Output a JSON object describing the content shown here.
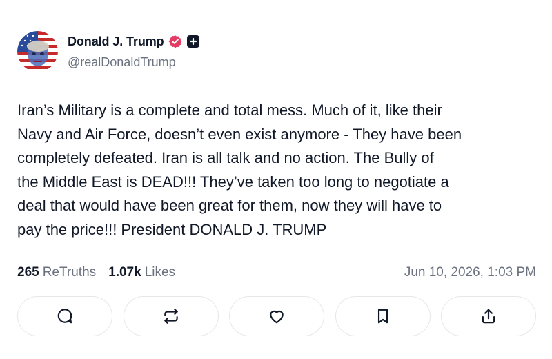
{
  "post": {
    "author": {
      "display_name": "Donald J. Trump",
      "handle": "@realDonaldTrump",
      "verified_icon": "verified-badge-icon",
      "plus_icon": "plus-badge-icon"
    },
    "text": "Iran’s Military is a complete and total mess. Much of it, like their\nNavy and Air Force, doesn’t even exist anymore - They have been\ncompletely defeated. Iran is all talk and no action. The Bully of\nthe Middle East is DEAD!!! They’ve taken too long to negotiate a\ndeal that would have been great for them, now they will have to\npay the price!!! President DONALD J. TRUMP",
    "stats": {
      "retruths_count": "265",
      "retruths_label": "ReTruths",
      "likes_count": "1.07k",
      "likes_label": "Likes"
    },
    "timestamp": "Jun 10, 2026, 1:03 PM",
    "actions": [
      "reply-icon",
      "retruth-icon",
      "like-icon",
      "bookmark-icon",
      "share-icon"
    ]
  },
  "colors": {
    "text": "#111827",
    "muted": "#6b7280",
    "verified": "#e23c64",
    "border": "#e5e7eb"
  }
}
